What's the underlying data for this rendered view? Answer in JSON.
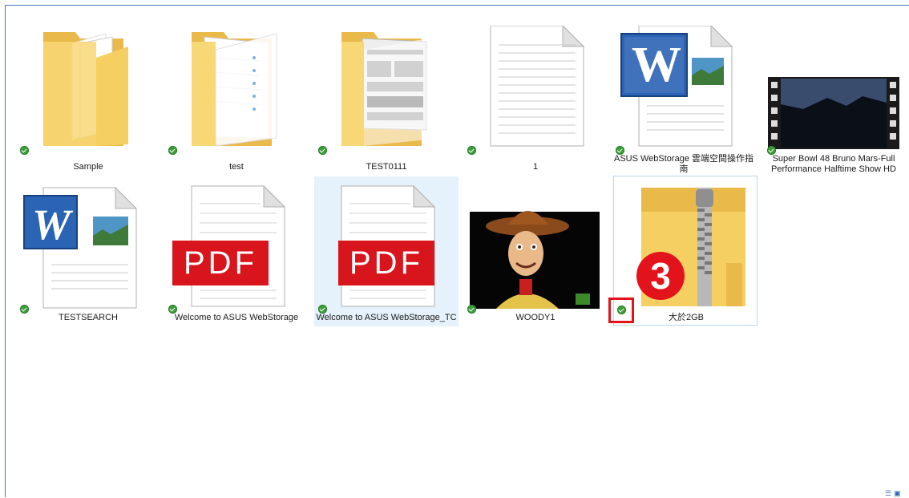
{
  "items": [
    {
      "label": "Sample",
      "type": "folder"
    },
    {
      "label": "test",
      "type": "folder"
    },
    {
      "label": "TEST0111",
      "type": "folder"
    },
    {
      "label": "1",
      "type": "text-document"
    },
    {
      "label": "ASUS WebStorage 雲端空間操作指南",
      "type": "word-document"
    },
    {
      "label": "Super Bowl 48 Bruno Mars-Full Performance Halftime Show HD",
      "type": "video"
    },
    {
      "label": "TESTSEARCH",
      "type": "word-document"
    },
    {
      "label": "Welcome to ASUS WebStorage",
      "type": "pdf"
    },
    {
      "label": "Welcome to ASUS WebStorage_TC",
      "type": "pdf"
    },
    {
      "label": "WOODY1",
      "type": "image"
    },
    {
      "label": "大於2GB",
      "type": "zip-folder"
    }
  ],
  "pdf_text": "PDF",
  "word_letter": "W",
  "annotation_number": "3",
  "colors": {
    "accent": "#4a78b5",
    "sync_ok": "#3aa03a",
    "highlight_red": "#e3131b",
    "folder": "#f8d775"
  },
  "status_icons": [
    "sync-ok-icon"
  ],
  "view_icons": [
    "details-view-icon",
    "large-icons-view-icon"
  ]
}
